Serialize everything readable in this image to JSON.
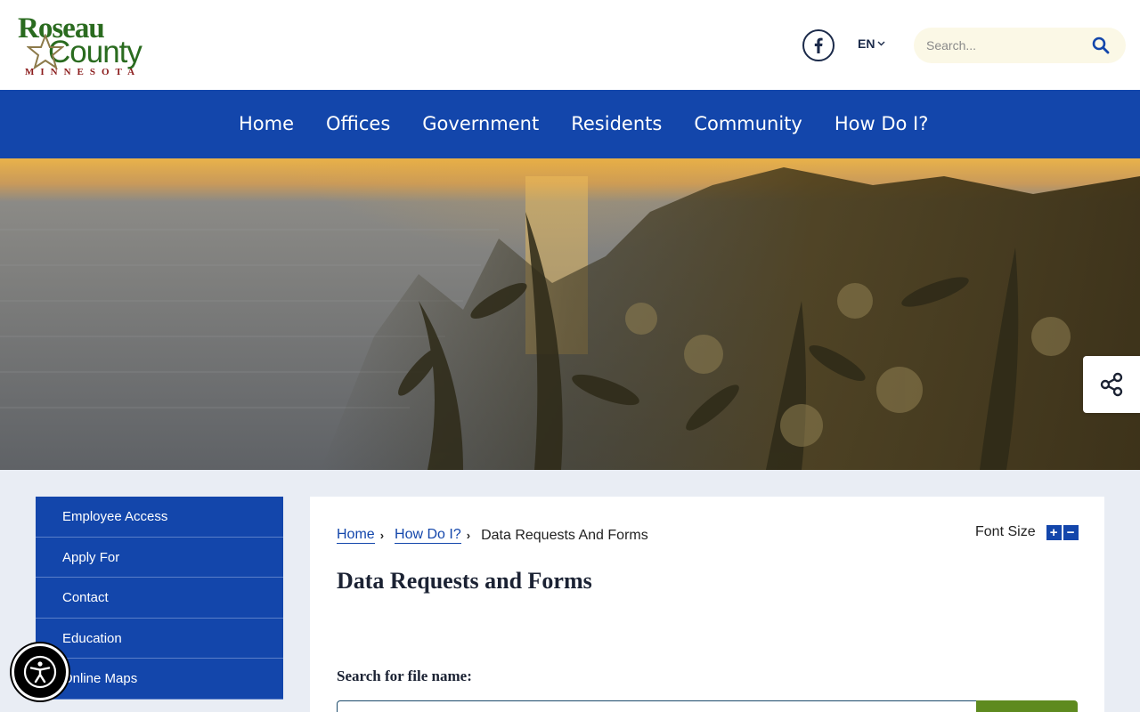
{
  "logo": {
    "line1": "Roseau",
    "line2": "County",
    "state": "MINNESOTA"
  },
  "header": {
    "language": "EN",
    "search_placeholder": "Search..."
  },
  "nav": {
    "items": [
      "Home",
      "Offices",
      "Government",
      "Residents",
      "Community",
      "How Do I?"
    ]
  },
  "sidebar": {
    "items": [
      "Employee Access",
      "Apply For",
      "Contact",
      "Education",
      "Online Maps"
    ]
  },
  "breadcrumb": {
    "home": "Home",
    "parent": "How Do I?",
    "current": "Data Requests And Forms"
  },
  "font_size": {
    "label": "Font Size",
    "increase": "+",
    "decrease": "−"
  },
  "page": {
    "title": "Data Requests and Forms",
    "search_label": "Search for file name:"
  },
  "colors": {
    "nav_blue": "#1346ab",
    "logo_green": "#2a6b1f",
    "search_bg": "#fbf8e6",
    "submit_green": "#5e8a1f"
  },
  "icons": {
    "social": "facebook-icon",
    "search": "search-icon",
    "share": "share-icon",
    "accessibility": "accessibility-icon"
  }
}
